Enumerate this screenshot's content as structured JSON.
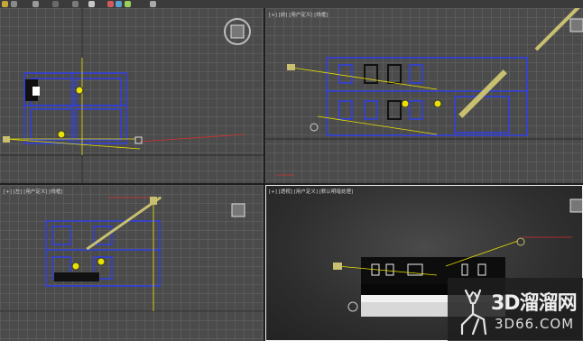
{
  "toolbar": {
    "icons": [
      "toolbar-icon-1",
      "toolbar-icon-2",
      "toolbar-icon-3",
      "toolbar-icon-4",
      "toolbar-icon-5",
      "toolbar-icon-6",
      "toolbar-icon-7",
      "toolbar-icon-8",
      "toolbar-icon-9",
      "toolbar-icon-10"
    ]
  },
  "viewports": {
    "top": {
      "label": ""
    },
    "front": {
      "label": "[+] [前] [用户定义] [线框]"
    },
    "left": {
      "label": "[+] [左] [用户定义] [线框]"
    },
    "perspective": {
      "label": "[+] [透视] [用户定义] [默认明暗处理]"
    }
  },
  "watermark": {
    "main": "3D溜溜网",
    "sub": "3D66.COM",
    "icon": "deer-logo-icon"
  },
  "colors": {
    "grid_bg": "#4b4b4b",
    "wire_blue": "#2a3cff",
    "gizmo_yellow": "#e8e000",
    "light_red": "#d23030",
    "persp_bg": "#2f2f2f"
  }
}
